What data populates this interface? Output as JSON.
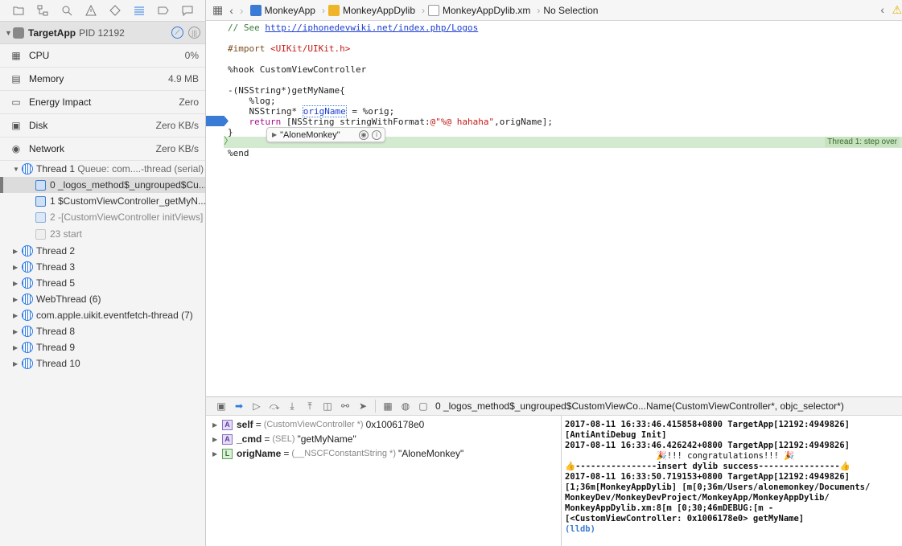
{
  "navigator": {
    "target": {
      "name": "TargetApp",
      "pid": "PID 12192"
    },
    "gauges": [
      {
        "label": "CPU",
        "value": "0%",
        "icon": "cpu-icon"
      },
      {
        "label": "Memory",
        "value": "4.9 MB",
        "icon": "memory-icon"
      },
      {
        "label": "Energy Impact",
        "value": "Zero",
        "icon": "battery-icon"
      },
      {
        "label": "Disk",
        "value": "Zero KB/s",
        "icon": "disk-icon"
      },
      {
        "label": "Network",
        "value": "Zero KB/s",
        "icon": "network-icon"
      }
    ],
    "thread1": {
      "label": "Thread 1",
      "queue": "Queue: com....-thread (serial)"
    },
    "frames": [
      "0 _logos_method$_ungrouped$Cu...",
      "1 $CustomViewController_getMyN...",
      "2 -[CustomViewController initViews]",
      "23 start"
    ],
    "threads": [
      "Thread 2",
      "Thread 3",
      "Thread 5",
      "WebThread (6)",
      "com.apple.uikit.eventfetch-thread (7)",
      "Thread 8",
      "Thread 9",
      "Thread 10"
    ]
  },
  "jumpbar": {
    "crumbs": [
      "MonkeyApp",
      "MonkeyAppDylib",
      "MonkeyAppDylib.xm",
      "No Selection"
    ]
  },
  "code": {
    "line1_prefix": "// See ",
    "line1_link": "http://iphonedevwiki.net/index.php/Logos",
    "line2_pp": "#import ",
    "line2_str": "<UIKit/UIKit.h>",
    "line3": "%hook CustomViewController",
    "line4": "-(NSString*)getMyName{",
    "line5": "    %log;",
    "line6a": "    NSString* ",
    "line6b": "origName",
    "line6c": " = %orig;",
    "line7_kw": "    return",
    "line7a": " [NSString stringWithFormat:",
    "line7_str": "@\"%@ hahaha\"",
    "line7b": ",origName];",
    "line8": "}",
    "line9": "%end",
    "step_label": "Thread 1: step over",
    "popover_value": "\"AloneMonkey\""
  },
  "debugbar": {
    "frame_text": "0 _logos_method$_ungrouped$CustomViewCo...Name(CustomViewController*, objc_selector*)"
  },
  "variables": [
    {
      "badge": "A",
      "name": "self",
      "type": "(CustomViewController *)",
      "value": "0x1006178e0"
    },
    {
      "badge": "A",
      "name": "_cmd",
      "type": "(SEL)",
      "value": "\"getMyName\""
    },
    {
      "badge": "L",
      "name": "origName",
      "type": "(__NSCFConstantString *)",
      "value": "\"AloneMonkey\""
    }
  ],
  "console": {
    "lines": [
      "2017-08-11 16:33:46.415858+0800 TargetApp[12192:4949826]",
      "[AntiAntiDebug Init]",
      "2017-08-11 16:33:46.426242+0800 TargetApp[12192:4949826]",
      "                  🎉!!! congratulations!!! 🎉",
      "👍----------------insert dylib success----------------👍",
      "2017-08-11 16:33:50.719153+0800 TargetApp[12192:4949826]",
      "[1;36m[MonkeyAppDylib] [m[0;36m/Users/alonemonkey/Documents/",
      "MonkeyDev/MonkeyDevProject/MonkeyApp/MonkeyAppDylib/",
      "MonkeyAppDylib.xm:8[m [0;30;46mDEBUG:[m -",
      "[<CustomViewController: 0x1006178e0> getMyName]"
    ],
    "prompt": "(lldb)"
  }
}
